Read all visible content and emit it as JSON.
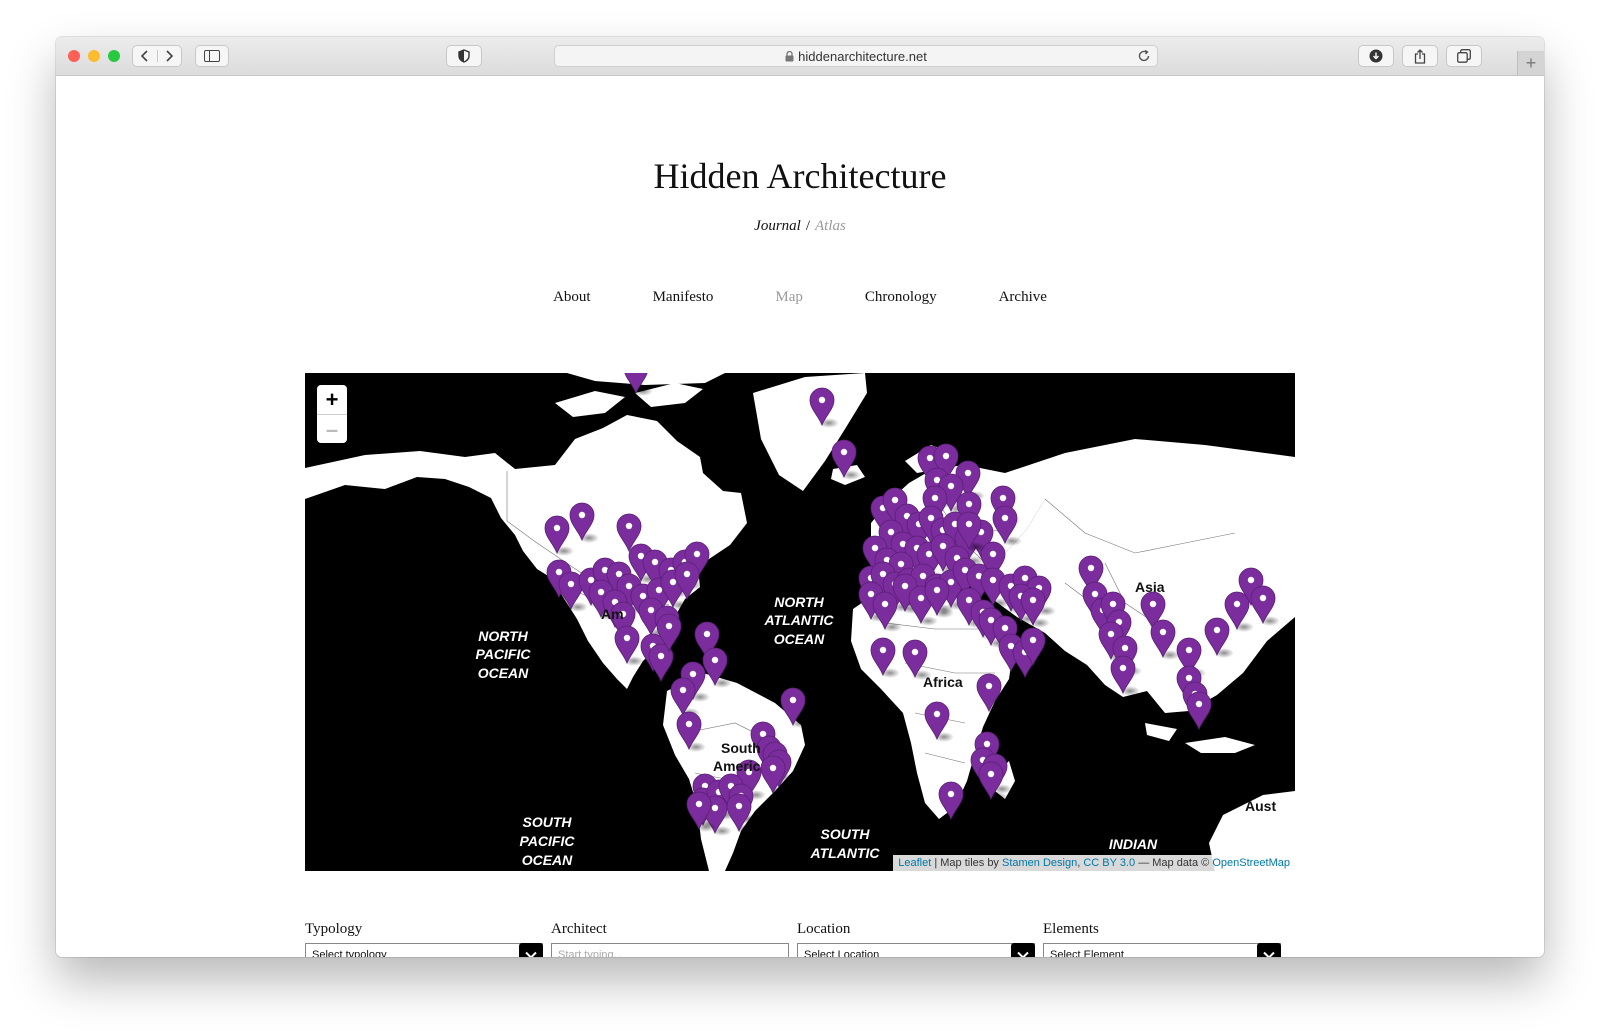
{
  "browser": {
    "url": "hiddenarchitecture.net"
  },
  "site": {
    "title": "Hidden Architecture",
    "subtitle_journal": "Journal",
    "subtitle_sep": "/",
    "subtitle_atlas": "Atlas"
  },
  "nav": {
    "items": [
      {
        "label": "About",
        "active": false
      },
      {
        "label": "Manifesto",
        "active": false
      },
      {
        "label": "Map",
        "active": true
      },
      {
        "label": "Chronology",
        "active": false
      },
      {
        "label": "Archive",
        "active": false
      }
    ]
  },
  "map": {
    "zoom_in": "+",
    "zoom_out": "–",
    "marker_color": "#7b2d9e",
    "labels": {
      "north_atlantic": [
        "NORTH",
        "ATLANTIC",
        "OCEAN"
      ],
      "north_pacific": [
        "NORTH",
        "PACIFIC",
        "OCEAN"
      ],
      "south_pacific": [
        "SOUTH",
        "PACIFIC",
        "OCEAN"
      ],
      "south_atlantic": [
        "SOUTH",
        "ATLANTIC"
      ],
      "indian": "INDIAN",
      "asia": "Asia",
      "africa": "Africa",
      "south_america": [
        "South",
        "Americ"
      ],
      "north_america_partial": "Am",
      "australia_partial": "Aust"
    },
    "attribution": {
      "leaflet": "Leaflet",
      "tiles_text": "| Map tiles by",
      "stamen": "Stamen Design",
      "comma": ",",
      "license": "CC BY 3.0",
      "data_text": "— Map data ©",
      "osm": "OpenStreetMap"
    }
  },
  "filters": {
    "typology": {
      "label": "Typology",
      "value": "Select typology"
    },
    "architect": {
      "label": "Architect",
      "placeholder": "Start typing..."
    },
    "location": {
      "label": "Location",
      "value": "Select Location"
    },
    "elements": {
      "label": "Elements",
      "value": "Select Element"
    }
  }
}
